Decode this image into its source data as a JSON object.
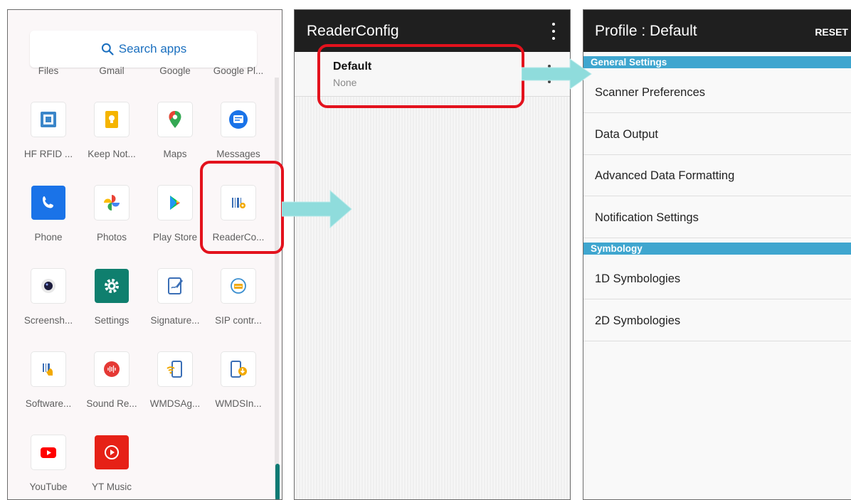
{
  "drawer": {
    "search_placeholder": "Search apps",
    "top_row": [
      "Files",
      "Gmail",
      "Google",
      "Google Pl..."
    ],
    "apps": [
      {
        "label": "HF RFID ...",
        "icon": "hf-rfid-icon"
      },
      {
        "label": "Keep Not...",
        "icon": "keep-notes-icon"
      },
      {
        "label": "Maps",
        "icon": "maps-icon"
      },
      {
        "label": "Messages",
        "icon": "messages-icon"
      },
      {
        "label": "Phone",
        "icon": "phone-icon"
      },
      {
        "label": "Photos",
        "icon": "photos-icon"
      },
      {
        "label": "Play Store",
        "icon": "play-store-icon"
      },
      {
        "label": "ReaderCo...",
        "icon": "reader-config-icon"
      },
      {
        "label": "Screensh...",
        "icon": "screenshot-icon"
      },
      {
        "label": "Settings",
        "icon": "settings-icon"
      },
      {
        "label": "Signature...",
        "icon": "signature-icon"
      },
      {
        "label": "SIP contr...",
        "icon": "sip-control-icon"
      },
      {
        "label": "Software...",
        "icon": "software-trigger-icon"
      },
      {
        "label": "Sound Re...",
        "icon": "sound-recorder-icon"
      },
      {
        "label": "WMDSAg...",
        "icon": "wmds-agent-icon"
      },
      {
        "label": "WMDSIn...",
        "icon": "wmds-installer-icon"
      },
      {
        "label": "YouTube",
        "icon": "youtube-icon"
      },
      {
        "label": "YT Music",
        "icon": "yt-music-icon"
      }
    ]
  },
  "reader": {
    "title": "ReaderConfig",
    "profile_name": "Default",
    "profile_sub": "None"
  },
  "profile": {
    "title": "Profile : Default",
    "reset_label": "RESET",
    "sections": [
      {
        "header": "General Settings",
        "items": [
          "Scanner Preferences",
          "Data Output",
          "Advanced Data Formatting",
          "Notification Settings"
        ]
      },
      {
        "header": "Symbology",
        "items": [
          "1D Symbologies",
          "2D Symbologies"
        ]
      }
    ]
  },
  "colors": {
    "highlight_red": "#e3121d",
    "arrow_cyan": "#8fdcdc",
    "section_blue": "#3fa6cf",
    "appbar_dark": "#1f1f1f"
  }
}
